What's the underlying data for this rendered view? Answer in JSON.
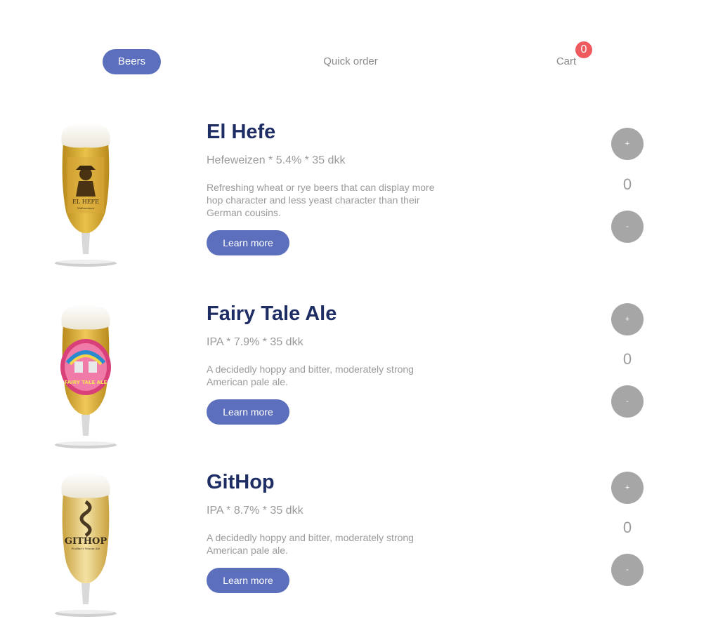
{
  "nav": {
    "beers_label": "Beers",
    "quick_order_label": "Quick order",
    "cart_label": "Cart",
    "cart_count": "0"
  },
  "colors": {
    "accent": "#5b6fbd",
    "title": "#1e2d64",
    "muted_text": "#9a9a9a",
    "qty_button": "#a6a6a6",
    "badge": "#ef5a5e"
  },
  "beers": [
    {
      "name": "El Hefe",
      "meta": "Hefeweizen * 5.4% * 35 dkk",
      "description": "Refreshing wheat or rye beers that can display more hop character and less yeast character than their German cousins.",
      "learn_more": "Learn more",
      "plus": "+",
      "minus": "-",
      "quantity": "0",
      "label_text": "EL HEFE",
      "label_sub": "Hefeweizen"
    },
    {
      "name": "Fairy Tale Ale",
      "meta": "IPA * 7.9% * 35 dkk",
      "description": "A decidedly hoppy and bitter, moderately strong American pale ale.",
      "learn_more": "Learn more",
      "plus": "+",
      "minus": "-",
      "quantity": "0",
      "label_text": "FAIRY TALE ALE"
    },
    {
      "name": "GitHop",
      "meta": "IPA * 8.7% * 35 dkk",
      "description": "A decidedly hoppy and bitter, moderately strong American pale ale.",
      "learn_more": "Learn more",
      "plus": "+",
      "minus": "-",
      "quantity": "0",
      "label_text": "GITHOP",
      "label_sub": "FooBar's Venom Ale"
    }
  ]
}
